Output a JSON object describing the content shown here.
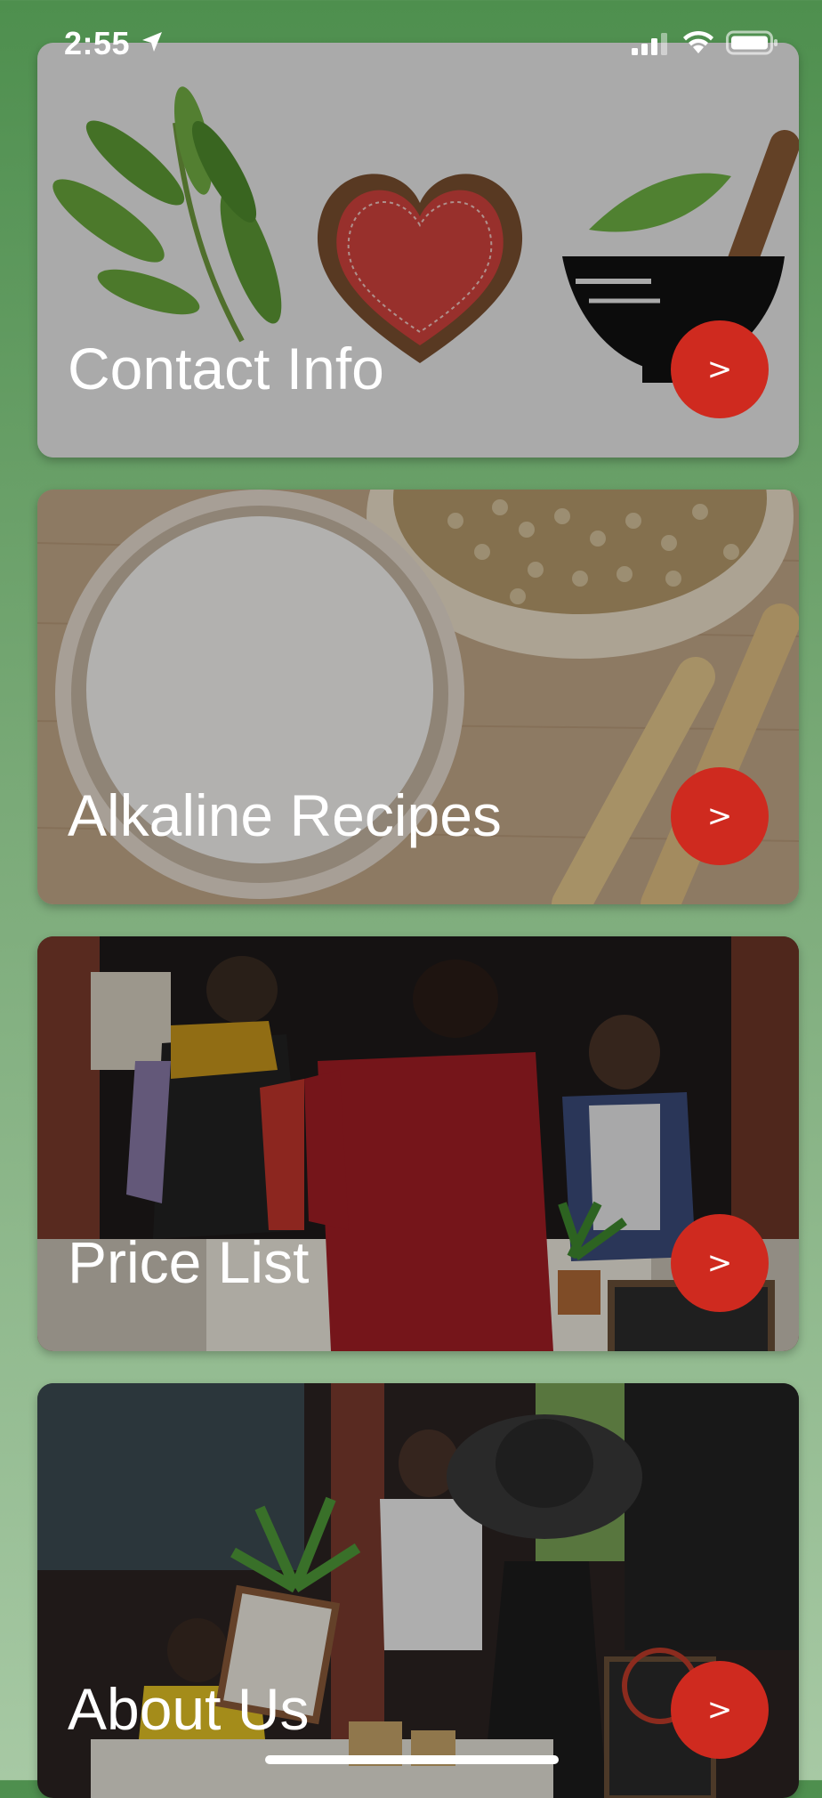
{
  "status_bar": {
    "time": "2:55"
  },
  "cards": [
    {
      "title": "Contact Info",
      "button_label": ">"
    },
    {
      "title": "Alkaline Recipes",
      "button_label": ">"
    },
    {
      "title": "Price List",
      "button_label": ">"
    },
    {
      "title": "About Us",
      "button_label": ">"
    }
  ],
  "colors": {
    "background_top": "#4e8f4e",
    "background_bottom": "#a7c9a4",
    "button": "#cf2a1f"
  }
}
